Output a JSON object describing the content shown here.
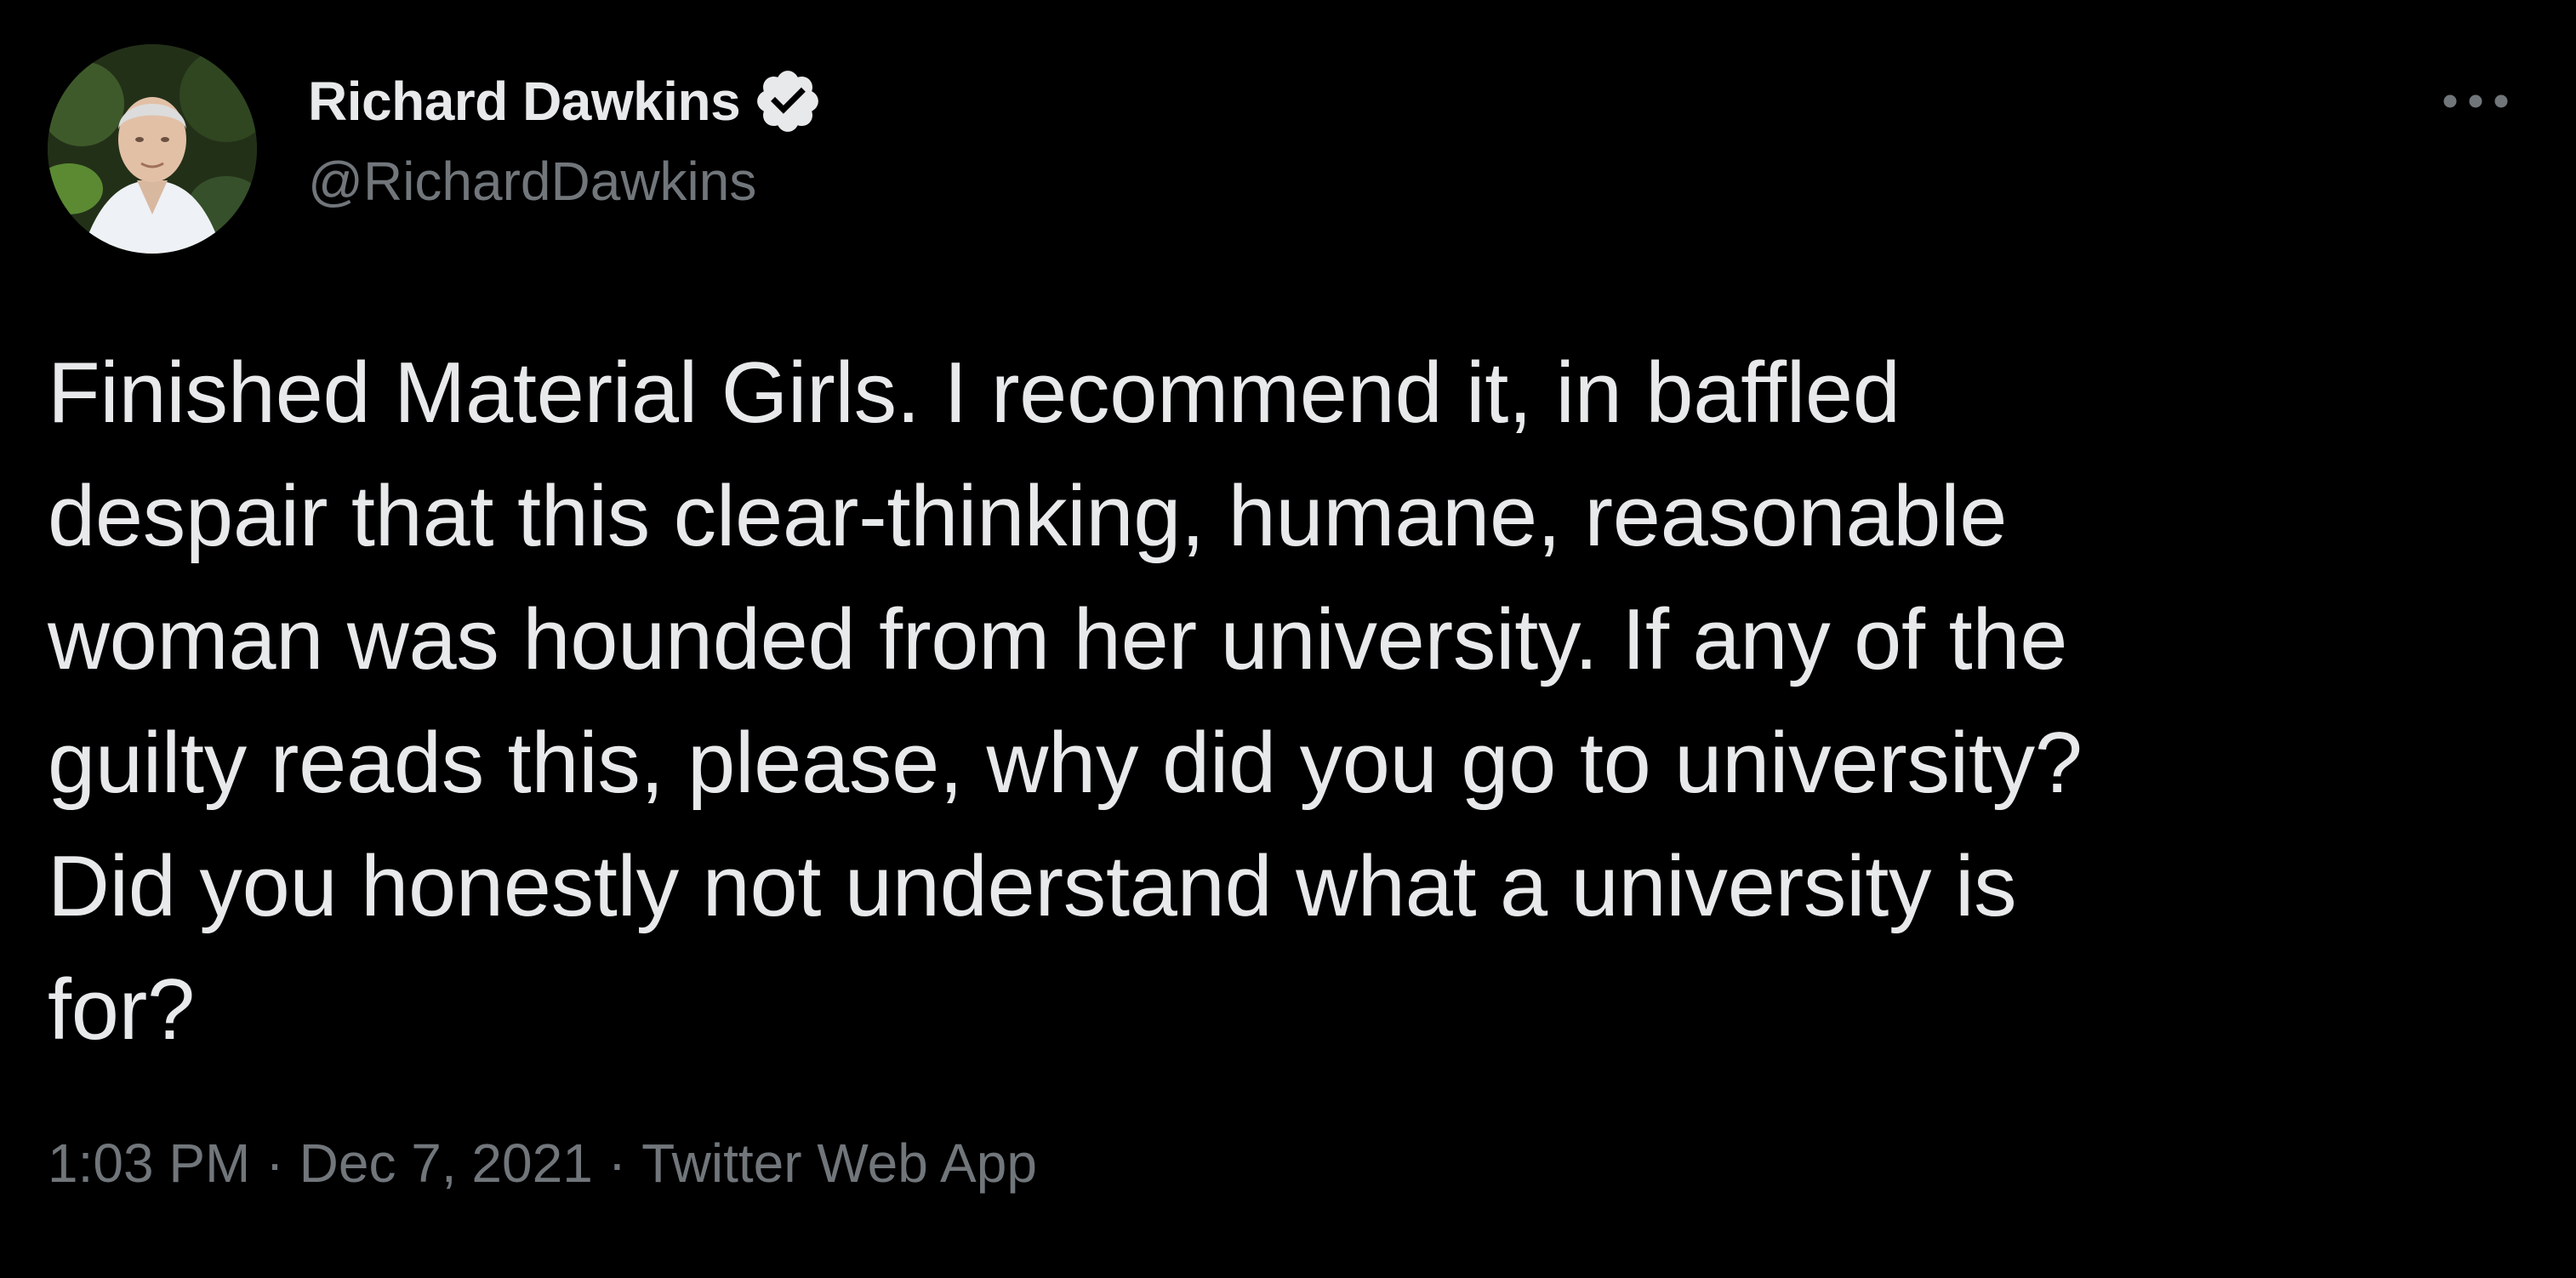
{
  "author": {
    "display_name": "Richard Dawkins",
    "handle": "@RichardDawkins",
    "verified": true,
    "avatar_icon": "profile-photo",
    "verified_icon": "verified-badge-icon"
  },
  "menu": {
    "more_icon": "more-options-icon"
  },
  "tweet": {
    "lines": [
      "Finished Material Girls. I recommend it, in baffled",
      "despair that this clear-thinking, humane, reasonable",
      "woman was hounded from her university. If any of the",
      "guilty reads this, please, why did you go to university?",
      "Did you honestly not understand what a university is",
      "for?"
    ]
  },
  "meta": {
    "time": "1:03 PM",
    "separator": "·",
    "date": "Dec 7, 2021",
    "source": "Twitter Web App"
  },
  "colors": {
    "background": "#000000",
    "primary_text": "#e7e9ea",
    "secondary_text": "#71767b"
  }
}
